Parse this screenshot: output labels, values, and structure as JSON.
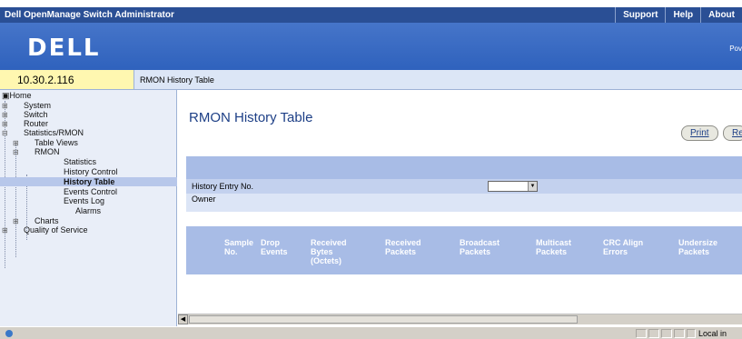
{
  "titlebar": {
    "app_title": "Dell OpenManage Switch Administrator",
    "links": [
      "Support",
      "Help",
      "About"
    ]
  },
  "banner": {
    "logo": "DELL",
    "powered": "Pov"
  },
  "ip_address": "10.30.2.116",
  "breadcrumb": "RMON History Table",
  "sidebar": {
    "home": "Home",
    "system": "System",
    "switch": "Switch",
    "router": "Router",
    "stats": "Statistics/RMON",
    "table_views": "Table Views",
    "rmon": "RMON",
    "statistics": "Statistics",
    "history_control": "History Control",
    "history_table": "History Table",
    "events_control": "Events Control",
    "events_log": "Events Log",
    "alarms": "Alarms",
    "charts": "Charts",
    "qos": "Quality of Service"
  },
  "main": {
    "title": "RMON History Table",
    "print_label": "Print",
    "refresh_label": "Re",
    "history_entry_label": "History Entry No.",
    "history_entry_value": "",
    "owner_label": "Owner",
    "columns": [
      {
        "l1": "Sample",
        "l2": "No.",
        "l3": ""
      },
      {
        "l1": "Drop",
        "l2": "Events",
        "l3": ""
      },
      {
        "l1": "Received",
        "l2": "Bytes",
        "l3": "(Octets)"
      },
      {
        "l1": "Received",
        "l2": "Packets",
        "l3": ""
      },
      {
        "l1": "Broadcast",
        "l2": "Packets",
        "l3": ""
      },
      {
        "l1": "Multicast",
        "l2": "Packets",
        "l3": ""
      },
      {
        "l1": "CRC Align",
        "l2": "Errors",
        "l3": ""
      },
      {
        "l1": "Undersize",
        "l2": "Packets",
        "l3": ""
      }
    ]
  },
  "statusbar": {
    "zone": "Local in"
  },
  "colors": {
    "titlebar": "#2a4f95",
    "banner": "#3d6fc6",
    "panel": "#a8bce6",
    "ipbar": "#fff7b0",
    "sidebar": "#e9eef8",
    "title_text": "#1d3f86"
  }
}
